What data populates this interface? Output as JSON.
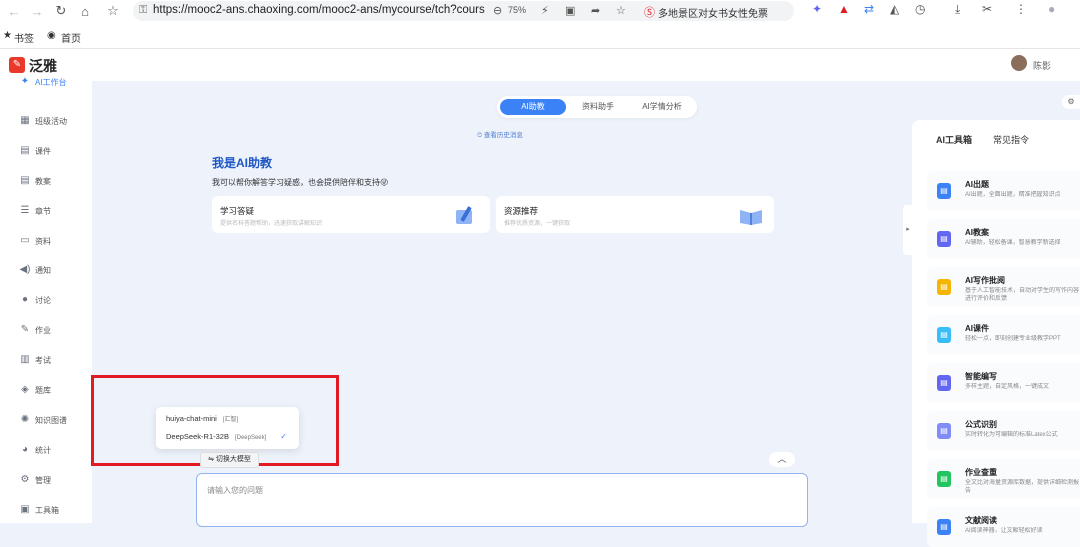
{
  "browser": {
    "url": "https://mooc2-ans.chaoxing.com/mooc2-ans/mycourse/tch?cours",
    "zoom": "75%",
    "ad_text": "多地景区对女书女性免票",
    "bookmarks": [
      "书签",
      "首页"
    ]
  },
  "app": {
    "logo": "泛雅",
    "user": "陈影"
  },
  "sidebar": {
    "items": [
      {
        "label": "AI工作台",
        "icon": "ai-icon"
      },
      {
        "label": "班级活动",
        "icon": "grid-icon"
      },
      {
        "label": "课件",
        "icon": "file-icon"
      },
      {
        "label": "教案",
        "icon": "file-icon"
      },
      {
        "label": "章节",
        "icon": "list-icon"
      },
      {
        "label": "资料",
        "icon": "folder-icon"
      },
      {
        "label": "通知",
        "icon": "speaker-icon"
      },
      {
        "label": "讨论",
        "icon": "chat-icon"
      },
      {
        "label": "作业",
        "icon": "edit-icon"
      },
      {
        "label": "考试",
        "icon": "exam-icon"
      },
      {
        "label": "题库",
        "icon": "layers-icon"
      },
      {
        "label": "知识图谱",
        "icon": "graph-icon"
      },
      {
        "label": "统计",
        "icon": "pie-icon"
      },
      {
        "label": "管理",
        "icon": "gear-icon"
      },
      {
        "label": "工具箱",
        "icon": "toolbox-icon"
      }
    ]
  },
  "main": {
    "tabs": [
      "AI助教",
      "资料助手",
      "AI学情分析"
    ],
    "history": "查看历史消息",
    "title": "我是AI助教",
    "subtitle": "我可以帮你解答学习疑惑，也会提供陪伴和支持😜",
    "cards": [
      {
        "title": "学习答疑",
        "desc": "提供名科答题帮助，迅速获取讲解知识"
      },
      {
        "title": "资源推荐",
        "desc": "推荐优质资源，一键获取"
      }
    ],
    "models": [
      {
        "name": "huiya-chat-mini",
        "tag": "[汇智]"
      },
      {
        "name": "DeepSeek-R1-32B",
        "tag": "[DeepSeek]"
      }
    ],
    "switch_label": "切换大模型",
    "input_placeholder": "请输入您的问题"
  },
  "right_panel": {
    "tabs": [
      "AI工具箱",
      "常见指令"
    ],
    "tools": [
      {
        "title": "AI出题",
        "desc": "AI出题，全面出题，精准把握知识点",
        "color": "#3b82f6"
      },
      {
        "title": "AI教案",
        "desc": "AI辅助，轻松备课，智慧教学新选择",
        "color": "#6366f1"
      },
      {
        "title": "AI写作批阅",
        "desc": "基于人工智能技术，自动对学生的写作内容进行评价和反馈",
        "color": "#f5b400"
      },
      {
        "title": "AI课件",
        "desc": "轻松一点，即刻创建专业级教学PPT",
        "color": "#38bdf8"
      },
      {
        "title": "智能编写",
        "desc": "多样主题，自定风格，一键成文",
        "color": "#6366f1"
      },
      {
        "title": "公式识别",
        "desc": "实时转化为可编辑的标准Latex公式",
        "color": "#818cf8"
      },
      {
        "title": "作业查重",
        "desc": "全文比对海量资源库数据，提供详细检测报告",
        "color": "#22c55e"
      },
      {
        "title": "文献阅读",
        "desc": "AI阅读神器，让文献轻松好读",
        "color": "#3b82f6"
      }
    ]
  }
}
